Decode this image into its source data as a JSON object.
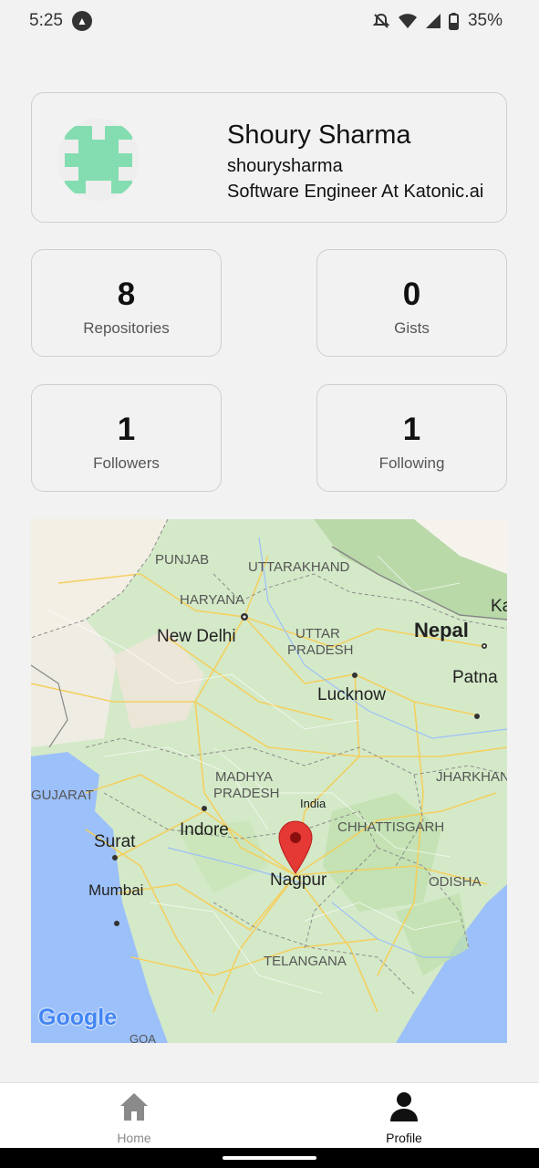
{
  "status_bar": {
    "time": "5:25",
    "battery": "35%"
  },
  "profile": {
    "name": "Shoury Sharma",
    "login": "shourysharma",
    "bio": "Software Engineer At Katonic.ai"
  },
  "stats": [
    {
      "value": "8",
      "label": "Repositories"
    },
    {
      "value": "0",
      "label": "Gists"
    },
    {
      "value": "1",
      "label": "Followers"
    },
    {
      "value": "1",
      "label": "Following"
    }
  ],
  "map": {
    "labels": {
      "punjab": "PUNJAB",
      "uttarakhand": "UTTARAKHAND",
      "haryana": "HARYANA",
      "new_delhi": "New Delhi",
      "uttar_pradesh_1": "UTTAR",
      "uttar_pradesh_2": "PRADESH",
      "nepal": "Nepal",
      "patna": "Patna",
      "lucknow": "Lucknow",
      "madhya_pradesh_1": "MADHYA",
      "madhya_pradesh_2": "PRADESH",
      "jharkhand": "JHARKHAN",
      "gujarat": "GUJARAT",
      "india": "India",
      "indore": "Indore",
      "chhattisgarh": "CHHATTISGARH",
      "surat": "Surat",
      "nagpur": "Nagpur",
      "odisha": "ODISHA",
      "mumbai": "Mumbai",
      "telangana": "TELANGANA",
      "goa": "GOA",
      "ka": "Ka",
      "google": "Google"
    },
    "marker_color": "#e53935"
  },
  "nav": {
    "home": "Home",
    "profile": "Profile"
  },
  "colors": {
    "background": "#f2f2f2",
    "avatar_pattern": "#84ddb0",
    "water": "#9cc0f9",
    "land": "#d4e9c8"
  }
}
